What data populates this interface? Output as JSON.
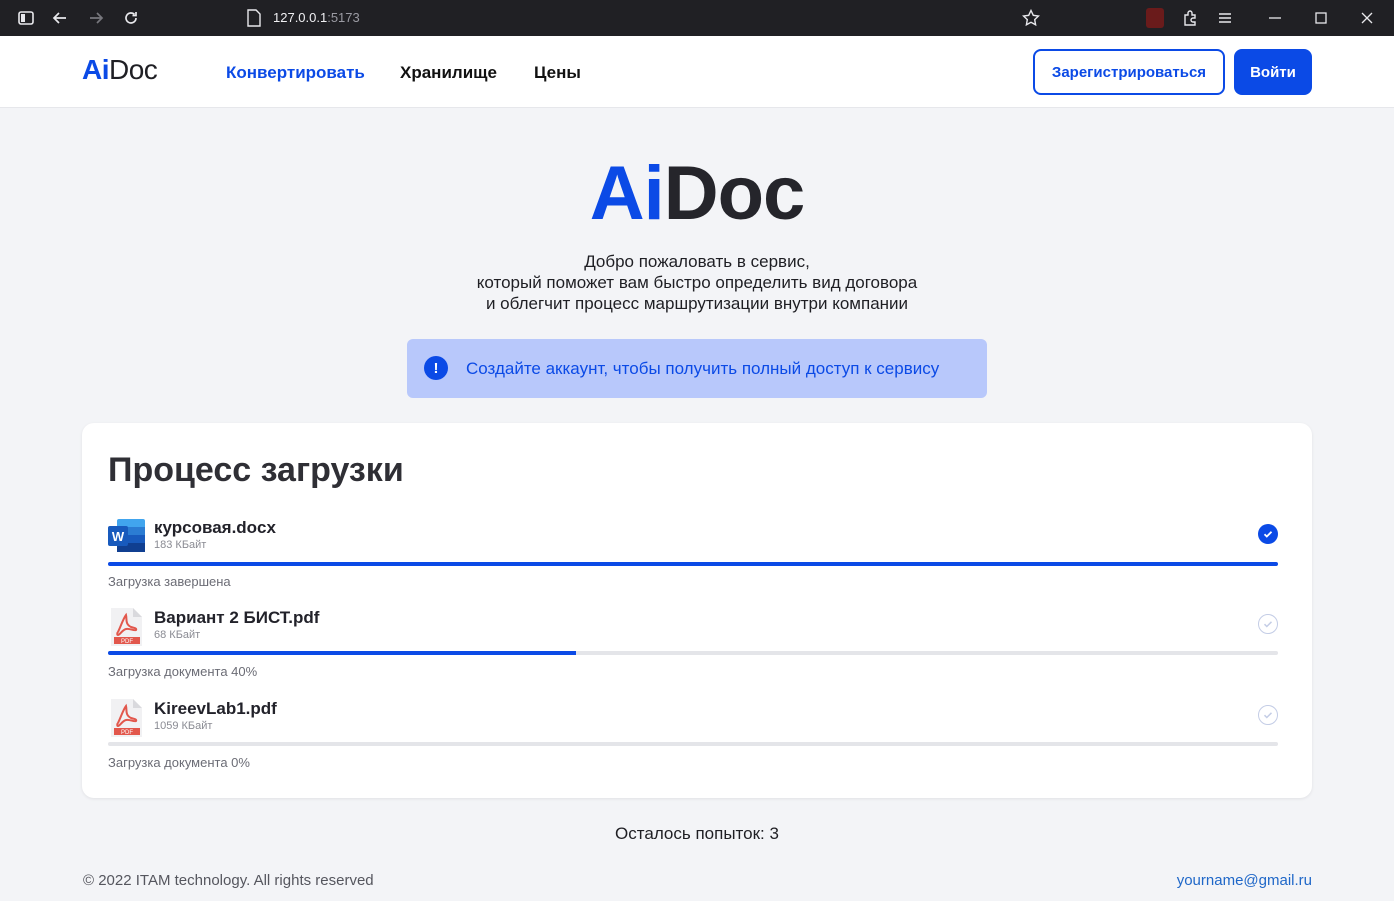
{
  "browser": {
    "url_host": "127.0.0.1",
    "url_port": ":5173"
  },
  "header": {
    "logo_ai": "Ai",
    "logo_doc": "Doc",
    "nav": [
      {
        "label": "Конвертировать",
        "active": true
      },
      {
        "label": "Хранилище",
        "active": false
      },
      {
        "label": "Цены",
        "active": false
      }
    ],
    "register_label": "Зарегистрироваться",
    "login_label": "Войти"
  },
  "hero": {
    "logo_ai": "Ai",
    "logo_doc": "Doc",
    "lines": [
      "Добро пожаловать в сервис,",
      "который поможет вам быстро определить вид договора",
      "и облегчит процесс маршрутизации внутри компании"
    ]
  },
  "alert": {
    "icon": "exclamation-icon",
    "text": "Создайте аккаунт, чтобы получить полный доступ к сервису"
  },
  "upload": {
    "title": "Процесс загрузки",
    "files": [
      {
        "name": "курсовая.docx",
        "size": "183 КБайт",
        "type": "word",
        "progress": 100,
        "status": "Загрузка завершена",
        "done": true
      },
      {
        "name": "Вариант 2 БИСТ.pdf",
        "size": "68 КБайт",
        "type": "pdf",
        "progress": 40,
        "status": "Загрузка документа 40%",
        "done": false
      },
      {
        "name": "KireevLab1.pdf",
        "size": "1059 КБайт",
        "type": "pdf",
        "progress": 0,
        "status": "Загрузка документа 0%",
        "done": false
      }
    ]
  },
  "attempts": "Осталось попыток: 3",
  "footer": {
    "copyright": "© 2022 ITAM technology. All rights reserved",
    "email": "yourname@gmail.ru"
  },
  "colors": {
    "accent": "#0b4ae6",
    "alert_bg": "#b8c8fb",
    "page_bg": "#f3f4f7"
  }
}
